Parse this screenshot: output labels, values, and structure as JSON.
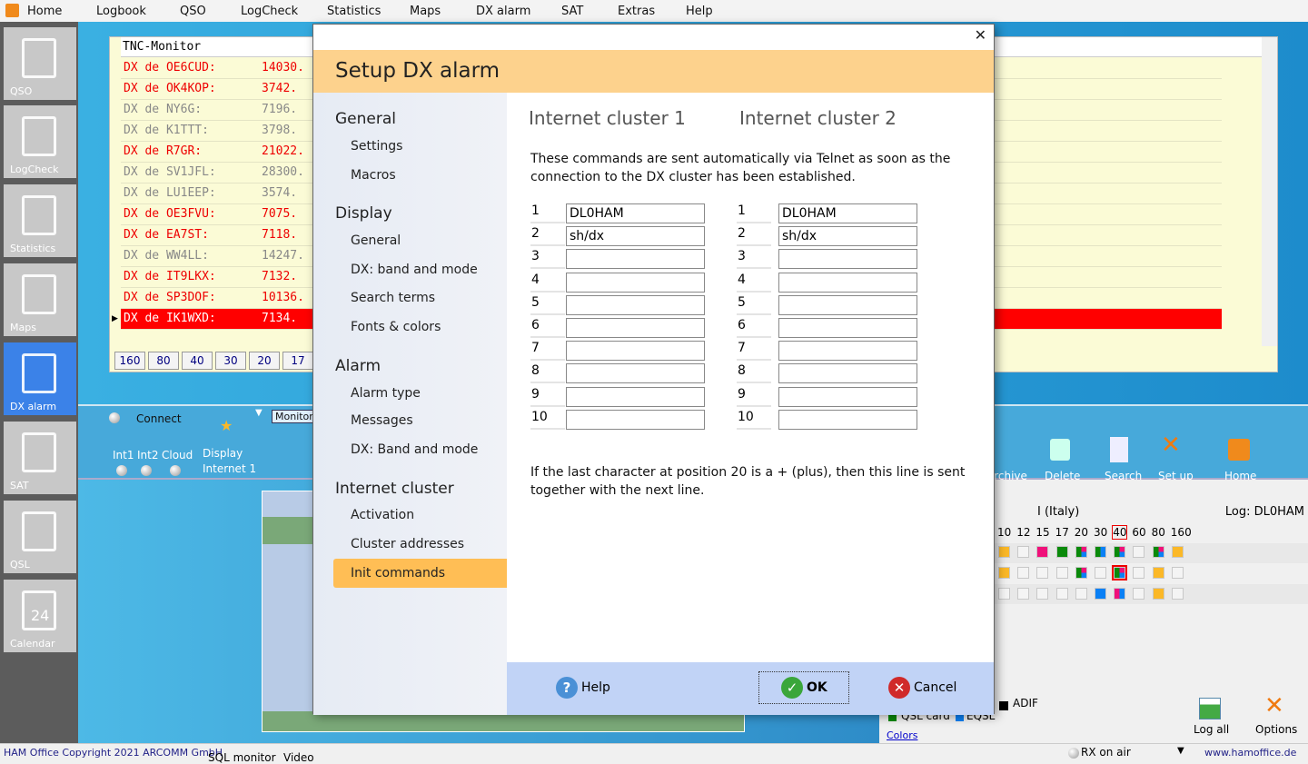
{
  "menu": [
    "Home",
    "Logbook",
    "QSO",
    "LogCheck",
    "Statistics",
    "Maps",
    "DX alarm",
    "SAT",
    "Extras",
    "Help"
  ],
  "sidebar": [
    {
      "label": "QSO",
      "icon": "notepad-icon"
    },
    {
      "label": "LogCheck",
      "icon": "magnifier-icon"
    },
    {
      "label": "Statistics",
      "icon": "chart-doc-icon"
    },
    {
      "label": "Maps",
      "icon": "globe-icon"
    },
    {
      "label": "DX alarm",
      "icon": "dx-monitor-icon",
      "active": true
    },
    {
      "label": "SAT",
      "icon": "satellite-icon"
    },
    {
      "label": "QSL",
      "icon": "cards-icon"
    },
    {
      "label": "Calendar",
      "icon": "calendar-icon"
    }
  ],
  "calendar_day": "24",
  "tnc": {
    "title": "TNC-Monitor",
    "rows": [
      {
        "call": "DX de OE6CUD:",
        "freq": "14030.",
        "color": "red"
      },
      {
        "call": "DX de OK4KOP:",
        "freq": "3742.",
        "color": "red"
      },
      {
        "call": "DX de NY6G:",
        "freq": "7196.",
        "color": "gray"
      },
      {
        "call": "DX de K1TTT:",
        "freq": "3798.",
        "color": "gray"
      },
      {
        "call": "DX de R7GR:",
        "freq": "21022.",
        "color": "red"
      },
      {
        "call": "DX de SV1JFL:",
        "freq": "28300.",
        "color": "gray"
      },
      {
        "call": "DX de LU1EEP:",
        "freq": "3574.",
        "color": "gray"
      },
      {
        "call": "DX de OE3FVU:",
        "freq": "7075.",
        "color": "red"
      },
      {
        "call": "DX de EA7ST:",
        "freq": "7118.",
        "color": "red"
      },
      {
        "call": "DX de WW4LL:",
        "freq": "14247.",
        "color": "gray"
      },
      {
        "call": "DX de IT9LKX:",
        "freq": "7132.",
        "color": "red"
      },
      {
        "call": "DX de SP3DOF:",
        "freq": "10136.",
        "color": "red"
      },
      {
        "call": "DX de IK1WXD:",
        "freq": "7134.",
        "color": "red",
        "selected": true
      }
    ],
    "bands": [
      "160",
      "80",
      "40",
      "30",
      "20",
      "17"
    ]
  },
  "toolbar": {
    "connect": "Connect",
    "int1": "Int1",
    "int2": "Int2",
    "cloud": "Cloud",
    "display": "Display",
    "display2": "Internet 1",
    "monitor_tab": "Monitor",
    "archive": "Archive",
    "delete": "Delete",
    "search": "Search",
    "setup": "Set up",
    "home": "Home"
  },
  "panel": {
    "country": "I (Italy)",
    "log": "Log: DL0HAM",
    "bands": [
      "10",
      "12",
      "15",
      "17",
      "20",
      "30",
      "40",
      "60",
      "80",
      "160"
    ],
    "highlight_band": "40",
    "grid": [
      [
        "o",
        "e",
        "p",
        "g",
        "gpb",
        "gb",
        "gpb",
        "e",
        "gpb",
        "o"
      ],
      [
        "o",
        "e",
        "e",
        "e",
        "gpb",
        "e",
        "gpb*",
        "e",
        "o",
        "e"
      ],
      [
        "e",
        "e",
        "e",
        "e",
        "e",
        "b",
        "pb",
        "e",
        "o",
        "e"
      ]
    ],
    "adif": "ADIF",
    "qsl_card": "QSL card",
    "eqsl": "EQSL",
    "colors_link": "Colors",
    "log_all": "Log all",
    "options": "Options"
  },
  "colors": {
    "o": "#fbb827",
    "p": "#f0107a",
    "g": "#0a8a0a",
    "b": "#0a80f5"
  },
  "status": {
    "copyright": "HAM Office Copyright 2021 ARCOMM GmbH",
    "sql": "SQL monitor",
    "video": "Video",
    "rx": "RX on air",
    "url": "www.hamoffice.de"
  },
  "dialog": {
    "title": "Setup DX alarm",
    "nav": [
      {
        "type": "h",
        "label": "General"
      },
      {
        "type": "i",
        "label": "Settings"
      },
      {
        "type": "i",
        "label": "Macros"
      },
      {
        "type": "h",
        "label": "Display"
      },
      {
        "type": "i",
        "label": "General"
      },
      {
        "type": "i",
        "label": "DX: band and mode"
      },
      {
        "type": "i",
        "label": "Search terms"
      },
      {
        "type": "i",
        "label": "Fonts & colors"
      },
      {
        "type": "h",
        "label": "Alarm"
      },
      {
        "type": "i",
        "label": "Alarm type"
      },
      {
        "type": "i",
        "label": "Messages"
      },
      {
        "type": "i",
        "label": "DX: Band and mode"
      },
      {
        "type": "h",
        "label": "Internet cluster"
      },
      {
        "type": "i",
        "label": "Activation"
      },
      {
        "type": "i",
        "label": "Cluster addresses"
      },
      {
        "type": "i",
        "label": "Init commands",
        "active": true
      }
    ],
    "cluster1": "Internet cluster 1",
    "cluster2": "Internet cluster 2",
    "intro": "These commands are sent automatically via Telnet as soon as the connection to the DX cluster has been established.",
    "commands1": [
      "DL0HAM",
      "sh/dx",
      "",
      "",
      "",
      "",
      "",
      "",
      "",
      ""
    ],
    "commands2": [
      "DL0HAM",
      "sh/dx",
      "",
      "",
      "",
      "",
      "",
      "",
      "",
      ""
    ],
    "note": "If the last character at position 20 is a + (plus), then this line is sent together with the next line.",
    "help": "Help",
    "ok": "OK",
    "cancel": "Cancel"
  }
}
